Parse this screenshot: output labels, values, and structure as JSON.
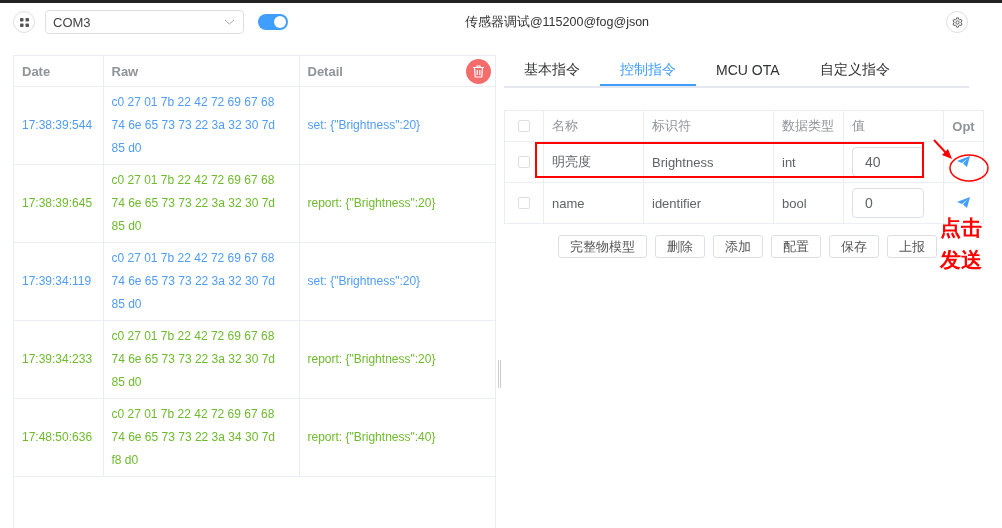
{
  "header": {
    "port": {
      "value": "COM3"
    },
    "connection_switch": {
      "on": true
    },
    "title": "传感器调试@115200@fog@json"
  },
  "log_table": {
    "columns": [
      "Date",
      "Raw",
      "Detail"
    ],
    "rows": [
      {
        "kind": "set",
        "date": "17:38:39:544",
        "raw": "c0 27 01 7b 22 42 72 69 67 68 74 6e 65 73 73 22 3a 32 30 7d 85 d0",
        "detail": "set: {\"Brightness\":20}"
      },
      {
        "kind": "report",
        "date": "17:38:39:645",
        "raw": "c0 27 01 7b 22 42 72 69 67 68 74 6e 65 73 73 22 3a 32 30 7d 85 d0",
        "detail": "report: {\"Brightness\":20}"
      },
      {
        "kind": "set",
        "date": "17:39:34:119",
        "raw": "c0 27 01 7b 22 42 72 69 67 68 74 6e 65 73 73 22 3a 32 30 7d 85 d0",
        "detail": "set: {\"Brightness\":20}"
      },
      {
        "kind": "report",
        "date": "17:39:34:233",
        "raw": "c0 27 01 7b 22 42 72 69 67 68 74 6e 65 73 73 22 3a 32 30 7d 85 d0",
        "detail": "report: {\"Brightness\":20}"
      },
      {
        "kind": "report",
        "date": "17:48:50:636",
        "raw": "c0 27 01 7b 22 42 72 69 67 68 74 6e 65 73 73 22 3a 34 30 7d f8 d0",
        "detail": "report: {\"Brightness\":40}"
      }
    ]
  },
  "tabs": [
    {
      "label": "基本指令",
      "selected": false
    },
    {
      "label": "控制指令",
      "selected": true
    },
    {
      "label": "MCU OTA",
      "selected": false
    },
    {
      "label": "自定义指令",
      "selected": false
    }
  ],
  "command_table": {
    "columns": [
      "名称",
      "标识符",
      "数据类型",
      "值",
      "Opt"
    ],
    "header_checked": false,
    "rows": [
      {
        "checked": false,
        "name": "明亮度",
        "identifier": "Brightness",
        "type": "int",
        "value": "40",
        "highlighted": true
      },
      {
        "checked": false,
        "name": "name",
        "identifier": "identifier",
        "type": "bool",
        "value": "0",
        "highlighted": false
      }
    ]
  },
  "buttons": [
    "完整物模型",
    "删除",
    "添加",
    "配置",
    "保存",
    "上报"
  ],
  "annotation": {
    "lines": [
      "点击",
      "发送"
    ]
  }
}
